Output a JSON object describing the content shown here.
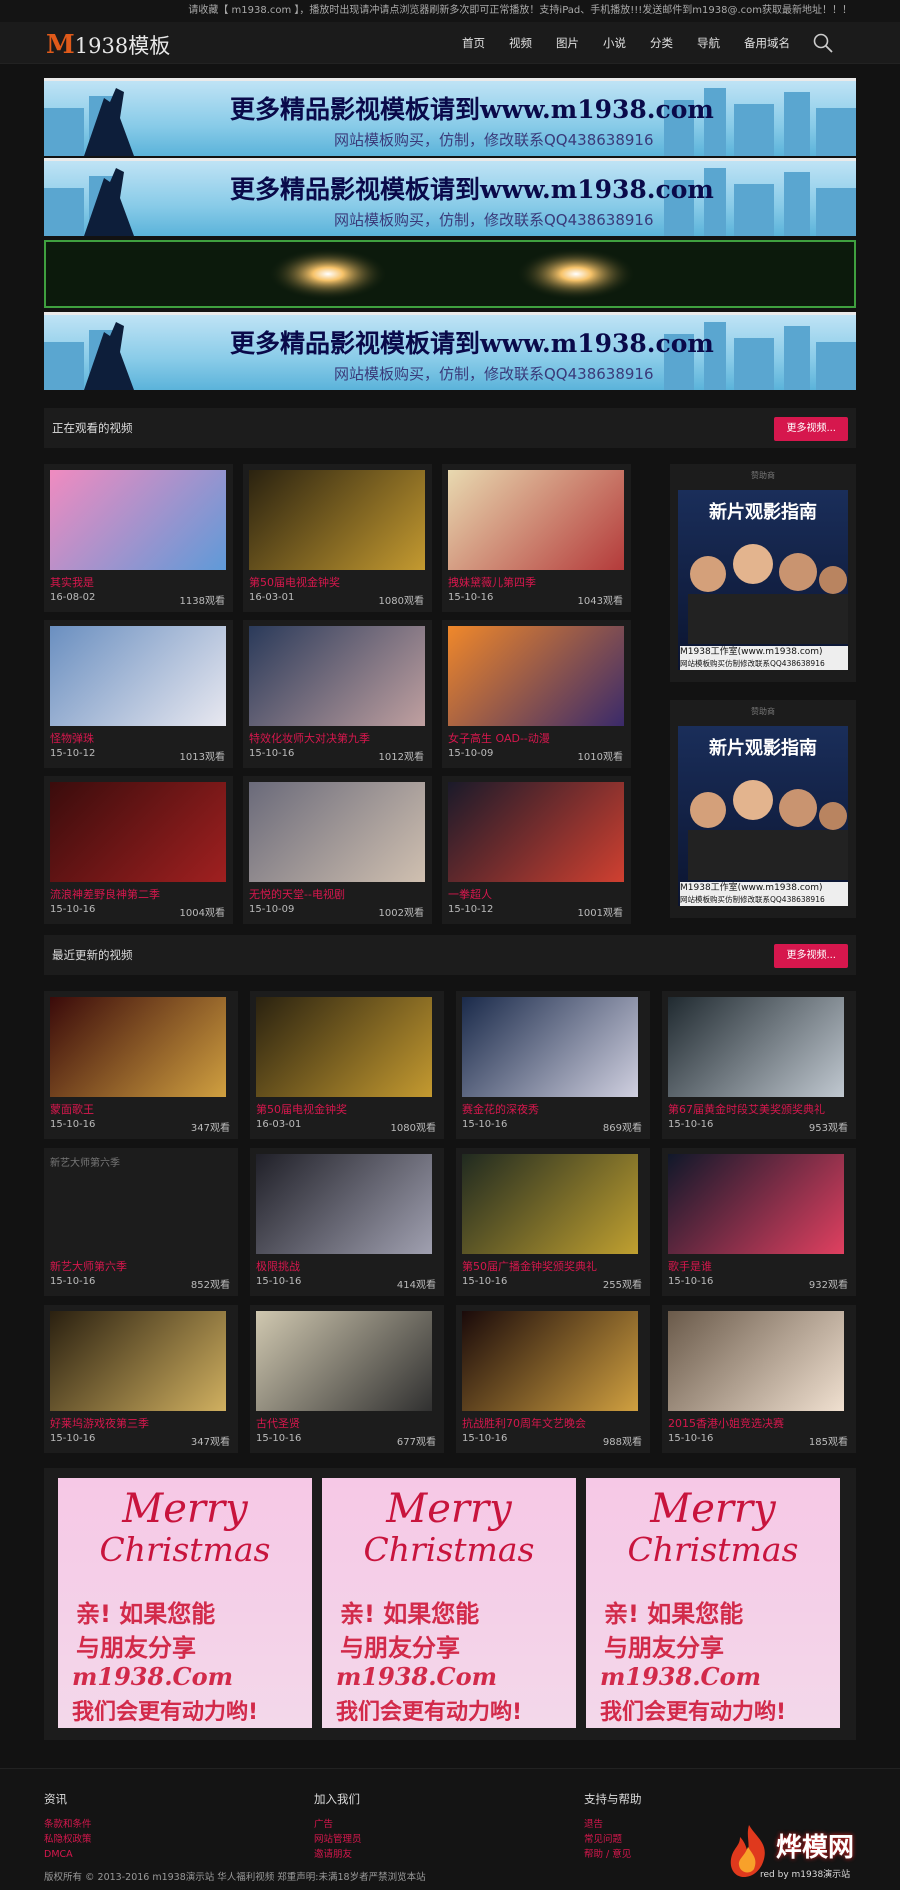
{
  "marquee": "请收藏【 m1938.com 】，播放时出现请冲请点浏览器刷新多次即可正常播放！支持iPad、手机播放!!!发送邮件到m1938@.com获取最新地址！！！",
  "logo": {
    "m": "M",
    "text": "1938模板"
  },
  "nav": [
    "首页",
    "视频",
    "图片",
    "小说",
    "分类",
    "导航",
    "备用域名"
  ],
  "banner": {
    "main": "更多精品影视模板请到www.m1938.com",
    "sub": "网站模板购买，仿制，修改联系QQ438638916"
  },
  "section1": {
    "title": "正在观看的视频",
    "more": "更多视频..."
  },
  "section2": {
    "title": "最近更新的视频",
    "more": "更多视频..."
  },
  "watching": [
    {
      "title": "其实我是",
      "date": "16-08-02",
      "views": "1138观看"
    },
    {
      "title": "第50届电视金钟奖",
      "date": "16-03-01",
      "views": "1080观看"
    },
    {
      "title": "拽妹黛薇儿第四季",
      "date": "15-10-16",
      "views": "1043观看"
    },
    {
      "title": "怪物弹珠",
      "date": "15-10-12",
      "views": "1013观看"
    },
    {
      "title": "特效化妆师大对决第九季",
      "date": "15-10-16",
      "views": "1012观看"
    },
    {
      "title": "女子高生 OAD--动漫",
      "date": "15-10-09",
      "views": "1010观看"
    },
    {
      "title": "流浪神差野良神第二季",
      "date": "15-10-16",
      "views": "1004观看"
    },
    {
      "title": "无悦的天堂--电视剧",
      "date": "15-10-09",
      "views": "1002观看"
    },
    {
      "title": "一拳超人",
      "date": "15-10-12",
      "views": "1001观看"
    }
  ],
  "side_ad": {
    "label": "赞助商",
    "t1": "新片观影指南",
    "t2": "M1938工作室(www.m1938.com)",
    "t3": "网站模板购买仿制修改联系QQ438638916"
  },
  "recent": [
    {
      "title": "蒙面歌王",
      "date": "15-10-16",
      "views": "347观看"
    },
    {
      "title": "第50届电视金钟奖",
      "date": "16-03-01",
      "views": "1080观看"
    },
    {
      "title": "赛金花的深夜秀",
      "date": "15-10-16",
      "views": "869观看"
    },
    {
      "title": "第67届黄金时段艾美奖颁奖典礼",
      "date": "15-10-16",
      "views": "953观看"
    },
    {
      "title": "新艺大师第六季",
      "date": "15-10-16",
      "views": "852观看",
      "alt": "新艺大师第六季"
    },
    {
      "title": "极限挑战",
      "date": "15-10-16",
      "views": "414观看"
    },
    {
      "title": "第50届广播金钟奖颁奖典礼",
      "date": "15-10-16",
      "views": "255观看"
    },
    {
      "title": "歌手是谁",
      "date": "15-10-16",
      "views": "932观看"
    },
    {
      "title": "好莱坞游戏夜第三季",
      "date": "15-10-16",
      "views": "347观看"
    },
    {
      "title": "古代圣贤",
      "date": "15-10-16",
      "views": "677观看"
    },
    {
      "title": "抗战胜利70周年文艺晚会",
      "date": "15-10-16",
      "views": "988观看"
    },
    {
      "title": "2015香港小姐竞选决赛",
      "date": "15-10-16",
      "views": "185观看"
    }
  ],
  "xmas": {
    "merry": "Merry",
    "christmas": "Christmas",
    "cn1": "亲! 如果您能",
    "cn2": "与朋友分享",
    "url": "m1938.Com",
    "cn3": "我们会更有动力哟!"
  },
  "footer": {
    "col1": {
      "head": "资讯",
      "links": [
        "条款和条件",
        "私隐权政策",
        "DMCA"
      ]
    },
    "col2": {
      "head": "加入我们",
      "links": [
        "广告",
        "网站管理员",
        "邀请朋友"
      ]
    },
    "col3": {
      "head": "支持与帮助",
      "links": [
        "退告",
        "常见问题",
        "帮助 / 意见"
      ]
    },
    "copyright": "版权所有 © 2013-2016 m1938演示站 华人福利视频  郑重声明:未满18岁者严禁浏览本站",
    "watermark": "烨模网",
    "watermark_sub": "red by m1938演示站"
  },
  "colors": {
    "accent": "#d6174d",
    "bg": "#121212",
    "card": "#1c1c1c"
  }
}
